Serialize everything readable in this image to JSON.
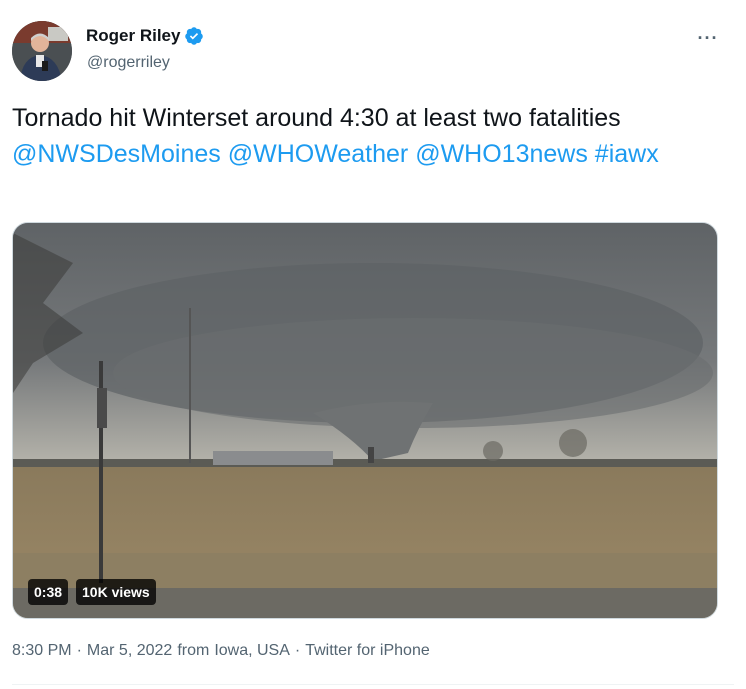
{
  "author": {
    "display_name": "Roger Riley",
    "handle": "@rogerriley",
    "verified": true
  },
  "more_menu": {
    "label": "···"
  },
  "tweet": {
    "text_plain": "Tornado hit Winterset around 4:30 at least two fatalities",
    "mentions": [
      "@NWSDesMoines",
      "@WHOWeather",
      "@WHO13news",
      "#iawx"
    ]
  },
  "video": {
    "duration": "0:38",
    "views": "10K views"
  },
  "meta": {
    "time": "8:30 PM",
    "sep1": "·",
    "date": "Mar 5, 2022",
    "from": "from",
    "location": "Iowa, USA",
    "sep2": "·",
    "source": "Twitter for iPhone"
  },
  "colors": {
    "link": "#1d9bf0",
    "secondary_text": "#536471",
    "verified_badge": "#1d9bf0"
  }
}
